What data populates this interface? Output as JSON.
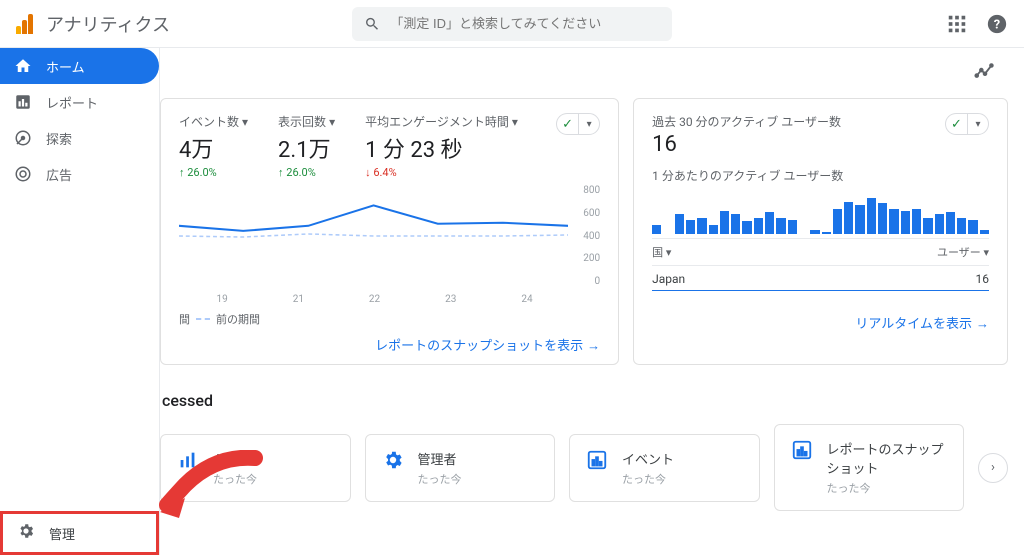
{
  "header": {
    "product_name": "アナリティクス",
    "search_placeholder": "「測定 ID」と検索してみてください"
  },
  "sidebar": {
    "items": [
      {
        "label": "ホーム"
      },
      {
        "label": "レポート"
      },
      {
        "label": "探索"
      },
      {
        "label": "広告"
      }
    ],
    "admin_label": "管理"
  },
  "metrics": [
    {
      "label": "イベント数",
      "value": "4万",
      "delta": "26.0%",
      "dir": "up"
    },
    {
      "label": "表示回数",
      "value": "2.1万",
      "delta": "26.0%",
      "dir": "up"
    },
    {
      "label": "平均エンゲージメント時間",
      "value": "1 分 23 秒",
      "delta": "6.4%",
      "dir": "down"
    }
  ],
  "chart_data": {
    "type": "line",
    "x_ticks": [
      "19",
      "21",
      "22",
      "23",
      "24"
    ],
    "y_ticks": [
      "800",
      "600",
      "400",
      "200",
      "0"
    ],
    "ylim": [
      0,
      800
    ],
    "series": [
      {
        "name": "現在の期間",
        "style": "solid",
        "values": [
          480,
          440,
          480,
          640,
          500,
          500,
          480
        ]
      },
      {
        "name": "前の期間",
        "style": "dashed",
        "values": [
          400,
          390,
          420,
          400,
          400,
          400,
          410
        ]
      }
    ],
    "legend_prev": "前の期間",
    "legend_trunc": "間"
  },
  "card_a_footer": "レポートのスナップショットを表示",
  "realtime": {
    "label": "過去 30 分のアクティブ ユーザー数",
    "value": "16",
    "sub_label": "1 分あたりのアクティブ ユーザー数",
    "bars_pct": [
      25,
      0,
      55,
      40,
      45,
      25,
      65,
      55,
      35,
      45,
      60,
      45,
      40,
      0,
      10,
      5,
      70,
      90,
      80,
      100,
      85,
      70,
      65,
      70,
      45,
      55,
      60,
      45,
      40,
      10
    ],
    "toggle_left": "国",
    "toggle_right": "ユーザー",
    "country": "Japan",
    "country_val": "16",
    "footer": "リアルタイムを表示"
  },
  "recent": {
    "title": "cessed",
    "items": [
      {
        "title": "ト",
        "sub": "たった今",
        "icon": "bars-blue"
      },
      {
        "title": "管理者",
        "sub": "たった今",
        "icon": "gear-blue"
      },
      {
        "title": "イベント",
        "sub": "たった今",
        "icon": "bars-box"
      },
      {
        "title": "レポートのスナップショット",
        "sub": "たった今",
        "icon": "bars-box"
      }
    ]
  }
}
